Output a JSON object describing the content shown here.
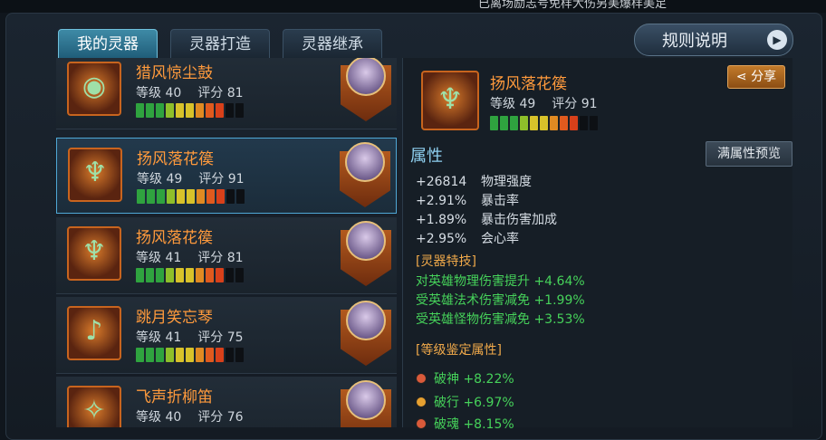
{
  "header_text": "已离场励志号免样大伤另美爆样美足",
  "tabs": [
    {
      "label": "我的灵器",
      "active": true
    },
    {
      "label": "灵器打造",
      "active": false
    },
    {
      "label": "灵器继承",
      "active": false
    }
  ],
  "rules_button": {
    "label": "规则说明",
    "icon": "play-arrow-icon"
  },
  "items": [
    {
      "name": "猎风惊尘鼓",
      "level_text": "等级 40",
      "score_text": "评分 81",
      "bar_filled": 9,
      "bar_total": 11,
      "selected": false,
      "item_icon": "drum-icon",
      "hero_icon": "hero-portrait-demon"
    },
    {
      "name": "扬风落花篌",
      "level_text": "等级 49",
      "score_text": "评分 91",
      "bar_filled": 9,
      "bar_total": 11,
      "selected": true,
      "item_icon": "harp-icon",
      "hero_icon": "hero-portrait-maiden"
    },
    {
      "name": "扬风落花篌",
      "level_text": "等级 41",
      "score_text": "评分 81",
      "bar_filled": 9,
      "bar_total": 11,
      "selected": false,
      "item_icon": "harp-icon",
      "hero_icon": "hero-portrait-maiden"
    },
    {
      "name": "跳月笑忘琴",
      "level_text": "等级 41",
      "score_text": "评分 75",
      "bar_filled": 9,
      "bar_total": 11,
      "selected": false,
      "item_icon": "lute-icon",
      "hero_icon": "hero-portrait-warrior"
    },
    {
      "name": "飞声折柳笛",
      "level_text": "等级 40",
      "score_text": "评分 76",
      "bar_filled": 9,
      "bar_total": 11,
      "selected": false,
      "item_icon": "flute-icon",
      "hero_icon": "hero-portrait-warrior"
    }
  ],
  "detail": {
    "name": "扬风落花篌",
    "level_text": "等级 49",
    "score_text": "评分 91",
    "bar_filled": 9,
    "bar_total": 11,
    "share_label": "分享",
    "section_title": "属性",
    "preview_label": "满属性预览",
    "attributes": [
      {
        "value": "+26814",
        "label": "物理强度"
      },
      {
        "value": "+2.91%",
        "label": "暴击率"
      },
      {
        "value": "+1.89%",
        "label": "暴击伤害加成"
      },
      {
        "value": "+2.95%",
        "label": "会心率"
      }
    ],
    "skill_header": "[灵器特技]",
    "skills": [
      "对英雄物理伤害提升 +4.64%",
      "受英雄法术伤害减免 +1.99%",
      "受英雄怪物伤害减免 +3.53%"
    ],
    "grade_header": "[等级鉴定属性]",
    "grades": [
      {
        "text": "破神 +8.22%",
        "dot_color": "#d95a3a"
      },
      {
        "text": "破行 +6.97%",
        "dot_color": "#e6a030"
      },
      {
        "text": "破魂 +8.15%",
        "dot_color": "#d95a3a"
      }
    ]
  },
  "bar_colors": [
    "#2fa33f",
    "#2fa33f",
    "#2fa33f",
    "#8fbf2a",
    "#d8c22a",
    "#d8c22a",
    "#e08a22",
    "#e05a1e",
    "#d8401a"
  ]
}
